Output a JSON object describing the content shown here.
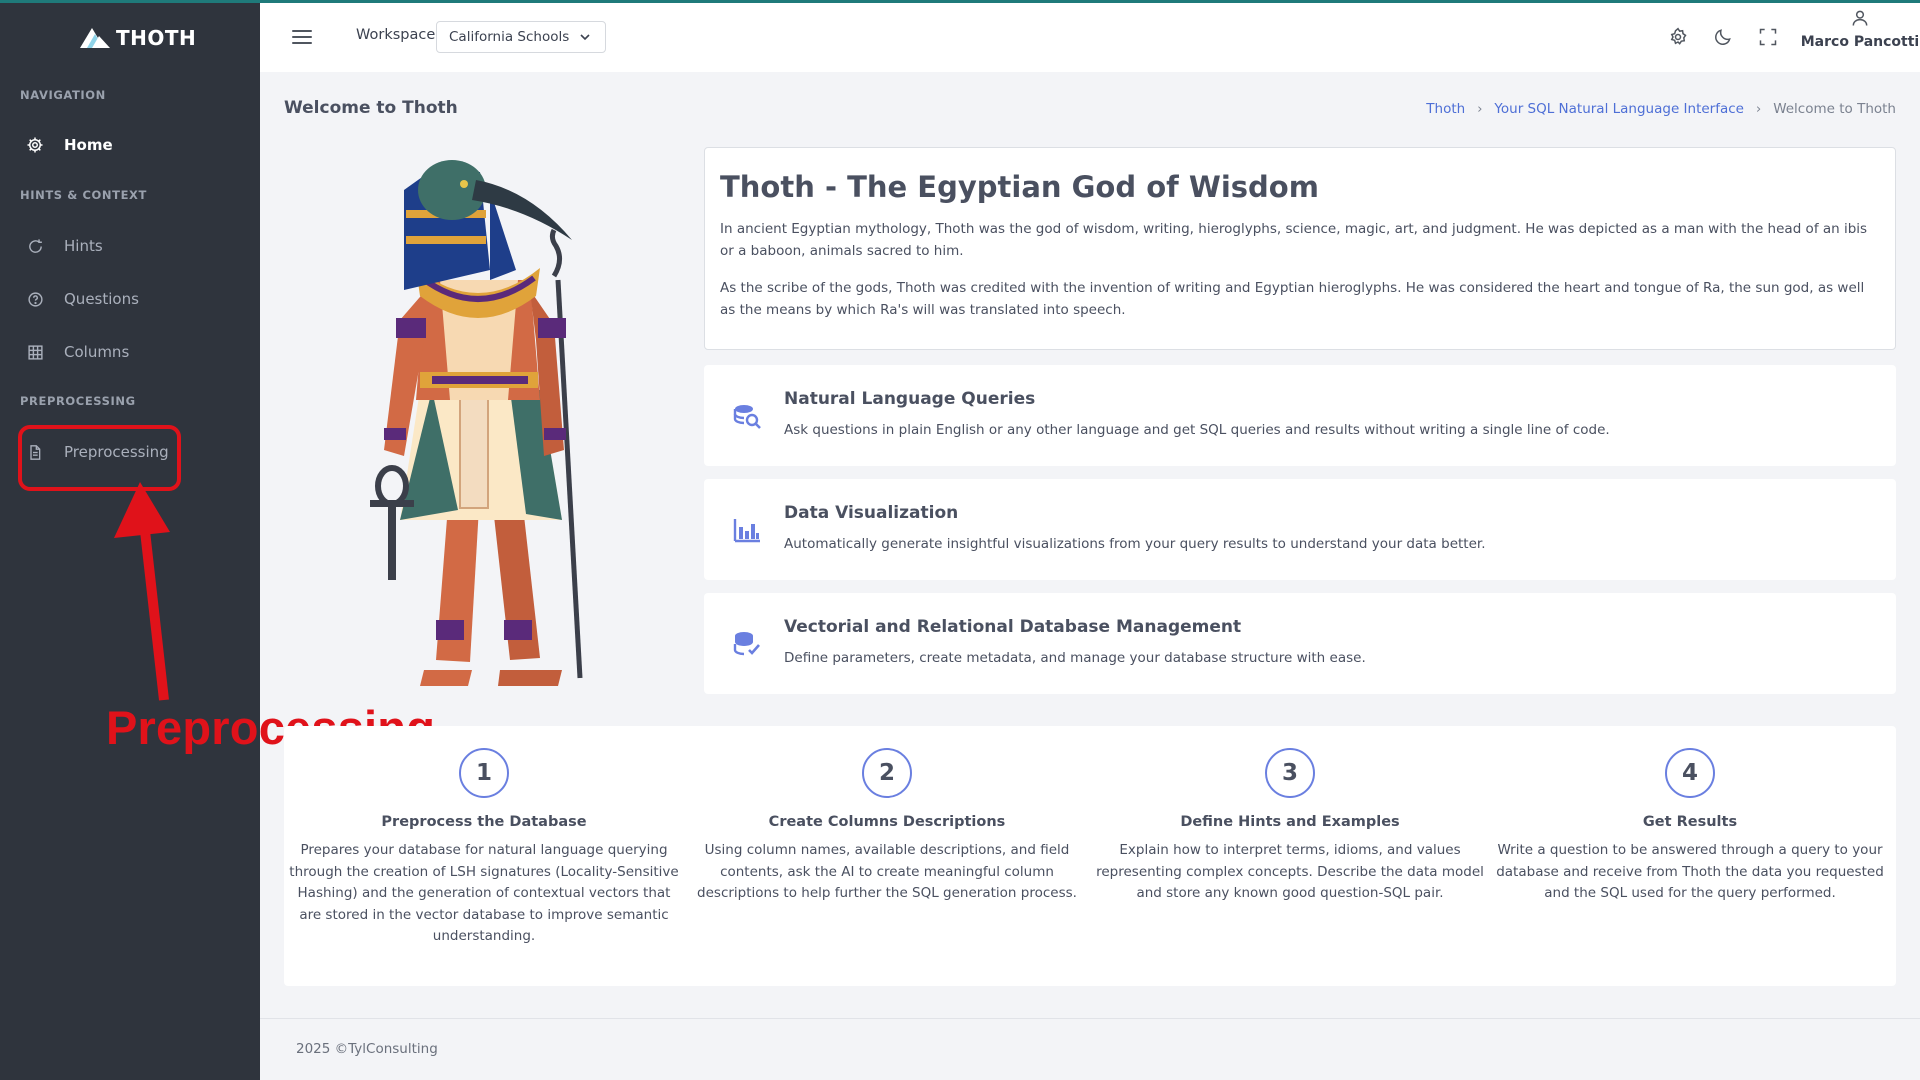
{
  "app": {
    "logo_text": "THOTH"
  },
  "sidebar": {
    "sections": [
      {
        "title": "NAVIGATION"
      },
      {
        "title": "HINTS & CONTEXT"
      },
      {
        "title": "PREPROCESSING"
      }
    ],
    "items": [
      {
        "label": "Home",
        "icon": "gear-icon",
        "active": true
      },
      {
        "label": "Hints",
        "icon": "refresh-icon"
      },
      {
        "label": "Questions",
        "icon": "question-circle-icon"
      },
      {
        "label": "Columns",
        "icon": "grid-icon"
      },
      {
        "label": "Preprocessing",
        "icon": "document-icon"
      }
    ]
  },
  "annotation": {
    "label": "Preprocessing",
    "color": "#e0121a"
  },
  "header": {
    "workspace_label": "Workspace",
    "workspace_value": "California Schools",
    "user_name": "Marco Pancotti",
    "icons": [
      "settings-icon",
      "moon-icon",
      "fullscreen-icon",
      "user-icon"
    ]
  },
  "page": {
    "title": "Welcome to Thoth",
    "breadcrumb": [
      "Thoth",
      "Your SQL Natural Language Interface",
      "Welcome to Thoth"
    ]
  },
  "intro": {
    "heading": "Thoth - The Egyptian God of Wisdom",
    "p1": "In ancient Egyptian mythology, Thoth was the god of wisdom, writing, hieroglyphs, science, magic, art, and judgment. He was depicted as a man with the head of an ibis or a baboon, animals sacred to him.",
    "p2": "As the scribe of the gods, Thoth was credited with the invention of writing and Egyptian hieroglyphs. He was considered the heart and tongue of Ra, the sun god, as well as the means by which Ra's will was translated into speech."
  },
  "features": [
    {
      "title": "Natural Language Queries",
      "desc": "Ask questions in plain English or any other language and get SQL queries and results without writing a single line of code.",
      "icon": "database-search-icon"
    },
    {
      "title": "Data Visualization",
      "desc": "Automatically generate insightful visualizations from your query results to understand your data better.",
      "icon": "bar-chart-icon"
    },
    {
      "title": "Vectorial and Relational Database Management",
      "desc": "Define parameters, create metadata, and manage your database structure with ease.",
      "icon": "database-check-icon"
    }
  ],
  "steps": [
    {
      "num": "1",
      "title": "Preprocess the Database",
      "desc": "Prepares your database for natural language querying through the creation of LSH signatures (Locality-Sensitive Hashing) and the generation of contextual vectors that are stored in the vector database to improve semantic understanding."
    },
    {
      "num": "2",
      "title": "Create Columns Descriptions",
      "desc": "Using column names, available descriptions, and field contents, ask the AI to create meaningful column descriptions to help further the SQL generation process."
    },
    {
      "num": "3",
      "title": "Define Hints and Examples",
      "desc": "Explain how to interpret terms, idioms, and values representing complex concepts. Describe the data model and store any known good question-SQL pair."
    },
    {
      "num": "4",
      "title": "Get Results",
      "desc": "Write a question to be answered through a query to your database and receive from Thoth the data you requested and the SQL used for the query performed."
    }
  ],
  "footer": {
    "text": "2025 ©TylConsulting"
  },
  "colors": {
    "sidebar_bg": "#2f343d",
    "accent": "#4e6fd6",
    "icon_purple": "#6a7fe0"
  }
}
